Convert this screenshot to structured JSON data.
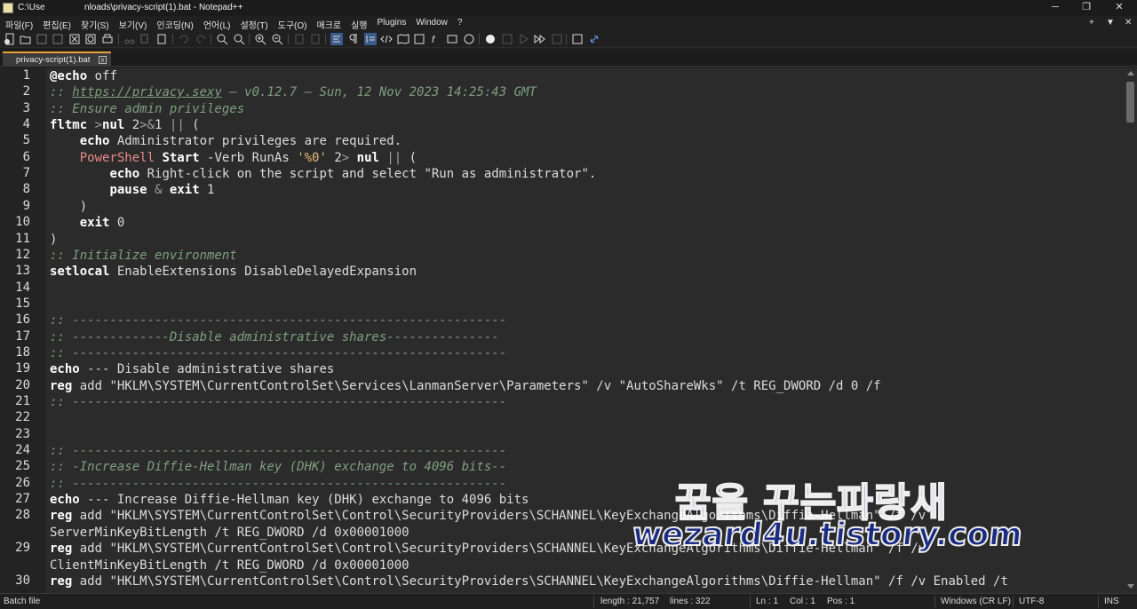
{
  "window": {
    "title": "C:\\Use                nloads\\privacy-script(1).bat - Notepad++",
    "minimize": "─",
    "maximize": "❐",
    "close": "✕"
  },
  "menu": {
    "items": [
      "파일(F)",
      "편집(E)",
      "찾기(S)",
      "보기(V)",
      "인코딩(N)",
      "언어(L)",
      "설정(T)",
      "도구(O)",
      "매크로",
      "실행",
      "Plugins",
      "Window",
      "?"
    ],
    "right_plus": "+",
    "right_down": "▼",
    "right_close": "✕"
  },
  "tab": {
    "label": "privacy-script(1).bat",
    "close": "x"
  },
  "editor": {
    "lines": [
      {
        "n": "1",
        "tokens": [
          [
            "k",
            "@echo"
          ],
          [
            "t",
            " off"
          ]
        ]
      },
      {
        "n": "2",
        "tokens": [
          [
            "c",
            ":: "
          ],
          [
            "u",
            "https://privacy.sexy"
          ],
          [
            "c",
            " — v0.12.7 — Sun, 12 Nov 2023 14:25:43 GMT"
          ]
        ]
      },
      {
        "n": "3",
        "tokens": [
          [
            "c",
            ":: Ensure admin privileges"
          ]
        ]
      },
      {
        "n": "4",
        "tokens": [
          [
            "k",
            "fltmc"
          ],
          [
            "o",
            " >"
          ],
          [
            "k",
            "nul"
          ],
          [
            "t",
            " 2"
          ],
          [
            "o",
            ">&"
          ],
          [
            "t",
            "1 "
          ],
          [
            "o",
            "||"
          ],
          [
            "t",
            " ("
          ]
        ]
      },
      {
        "n": "5",
        "tokens": [
          [
            "t",
            "    "
          ],
          [
            "k",
            "echo"
          ],
          [
            "t",
            " Administrator privileges are required."
          ]
        ]
      },
      {
        "n": "6",
        "tokens": [
          [
            "t",
            "    "
          ],
          [
            "p",
            "PowerShell"
          ],
          [
            "t",
            " "
          ],
          [
            "k",
            "Start"
          ],
          [
            "t",
            " -Verb RunAs "
          ],
          [
            "s",
            "'%0'"
          ],
          [
            "t",
            " 2"
          ],
          [
            "o",
            ">"
          ],
          [
            "t",
            " "
          ],
          [
            "k",
            "nul"
          ],
          [
            "t",
            " "
          ],
          [
            "o",
            "||"
          ],
          [
            "t",
            " ("
          ]
        ]
      },
      {
        "n": "7",
        "tokens": [
          [
            "t",
            "        "
          ],
          [
            "k",
            "echo"
          ],
          [
            "t",
            " Right-click on the script and select \"Run as administrator\"."
          ]
        ]
      },
      {
        "n": "8",
        "tokens": [
          [
            "t",
            "        "
          ],
          [
            "k",
            "pause"
          ],
          [
            "t",
            " "
          ],
          [
            "o",
            "&"
          ],
          [
            "t",
            " "
          ],
          [
            "k",
            "exit"
          ],
          [
            "t",
            " 1"
          ]
        ]
      },
      {
        "n": "9",
        "tokens": [
          [
            "t",
            "    )"
          ]
        ]
      },
      {
        "n": "10",
        "tokens": [
          [
            "t",
            "    "
          ],
          [
            "k",
            "exit"
          ],
          [
            "t",
            " 0"
          ]
        ]
      },
      {
        "n": "11",
        "tokens": [
          [
            "t",
            ")"
          ]
        ]
      },
      {
        "n": "12",
        "tokens": [
          [
            "c",
            ":: Initialize environment"
          ]
        ]
      },
      {
        "n": "13",
        "tokens": [
          [
            "k",
            "setlocal"
          ],
          [
            "t",
            " EnableExtensions DisableDelayedExpansion"
          ]
        ]
      },
      {
        "n": "14",
        "tokens": []
      },
      {
        "n": "15",
        "tokens": []
      },
      {
        "n": "16",
        "tokens": [
          [
            "c",
            ":: ----------------------------------------------------------"
          ]
        ]
      },
      {
        "n": "17",
        "tokens": [
          [
            "c",
            ":: -------------Disable administrative shares---------------"
          ]
        ]
      },
      {
        "n": "18",
        "tokens": [
          [
            "c",
            ":: ----------------------------------------------------------"
          ]
        ]
      },
      {
        "n": "19",
        "tokens": [
          [
            "k",
            "echo"
          ],
          [
            "t",
            " --- Disable administrative shares"
          ]
        ]
      },
      {
        "n": "20",
        "tokens": [
          [
            "k",
            "reg"
          ],
          [
            "t",
            " add \"HKLM\\SYSTEM\\CurrentControlSet\\Services\\LanmanServer\\Parameters\" /v \"AutoShareWks\" /t REG_DWORD /d 0 /f"
          ]
        ]
      },
      {
        "n": "21",
        "tokens": [
          [
            "c",
            ":: ----------------------------------------------------------"
          ]
        ]
      },
      {
        "n": "22",
        "tokens": []
      },
      {
        "n": "23",
        "tokens": []
      },
      {
        "n": "24",
        "tokens": [
          [
            "c",
            ":: ----------------------------------------------------------"
          ]
        ]
      },
      {
        "n": "25",
        "tokens": [
          [
            "c",
            ":: -Increase Diffie-Hellman key (DHK) exchange to 4096 bits--"
          ]
        ]
      },
      {
        "n": "26",
        "tokens": [
          [
            "c",
            ":: ----------------------------------------------------------"
          ]
        ]
      },
      {
        "n": "27",
        "tokens": [
          [
            "k",
            "echo"
          ],
          [
            "t",
            " --- Increase Diffie-Hellman key (DHK) exchange to 4096 bits"
          ]
        ]
      },
      {
        "n": "28",
        "tokens": [
          [
            "k",
            "reg"
          ],
          [
            "t",
            " add \"HKLM\\SYSTEM\\CurrentControlSet\\Control\\SecurityProviders\\SCHANNEL\\KeyExchangeAlgorithms\\Diffie-Hellman\" /f /v"
          ]
        ]
      },
      {
        "n": "",
        "tokens": [
          [
            "t",
            "ServerMinKeyBitLength /t REG_DWORD /d 0x00001000"
          ]
        ]
      },
      {
        "n": "29",
        "tokens": [
          [
            "k",
            "reg"
          ],
          [
            "t",
            " add \"HKLM\\SYSTEM\\CurrentControlSet\\Control\\SecurityProviders\\SCHANNEL\\KeyExchangeAlgorithms\\Diffie-Hellman\" /f /v"
          ]
        ]
      },
      {
        "n": "",
        "tokens": [
          [
            "t",
            "ClientMinKeyBitLength /t REG_DWORD /d 0x00001000"
          ]
        ]
      },
      {
        "n": "30",
        "tokens": [
          [
            "k",
            "reg"
          ],
          [
            "t",
            " add \"HKLM\\SYSTEM\\CurrentControlSet\\Control\\SecurityProviders\\SCHANNEL\\KeyExchangeAlgorithms\\Diffie-Hellman\" /f /v Enabled /t"
          ]
        ]
      }
    ]
  },
  "status": {
    "file_type": "Batch file",
    "length": "length : 21,757",
    "lines": "lines : 322",
    "ln": "Ln : 1",
    "col": "Col : 1",
    "pos": "Pos : 1",
    "eol": "Windows (CR LF)",
    "encoding": "UTF-8",
    "mode": "INS"
  },
  "watermark": {
    "korean": "꿈을 꾸는파랑새",
    "url": "wezard4u.tistory.com"
  },
  "toolbar_icons": [
    "new-file-icon",
    "open-file-icon",
    "save-icon",
    "save-all-icon",
    "close-icon",
    "close-all-icon",
    "print-icon",
    "cut-icon",
    "copy-icon",
    "paste-icon",
    "undo-icon",
    "redo-icon",
    "find-icon",
    "replace-icon",
    "zoom-in-icon",
    "zoom-out-icon",
    "sync-v-icon",
    "sync-h-icon",
    "word-wrap-icon",
    "show-all-chars-icon",
    "indent-guide-icon",
    "lang-xml-icon",
    "doc-map-icon",
    "doc-list-icon",
    "function-list-icon",
    "folder-workspace-icon",
    "monitoring-icon",
    "record-macro-icon",
    "stop-macro-icon",
    "play-macro-icon",
    "run-multiple-macro-icon",
    "save-macro-icon",
    "spell-check-icon",
    "link-icon"
  ]
}
